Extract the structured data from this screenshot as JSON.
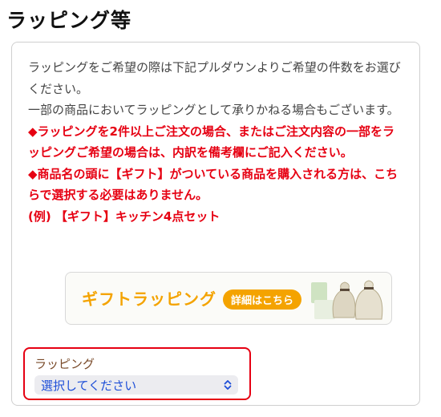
{
  "section": {
    "title": "ラッピング等"
  },
  "intro": {
    "normal": [
      "ラッピングをご希望の際は下記プルダウンよりご希望の件数をお選びください。",
      "一部の商品においてラッピングとして承りかねる場合もございます。"
    ],
    "notices": [
      "◆ラッピングを2件以上ご注文の場合、またはご注文内容の一部をラッピングご希望の場合は、内訳を備考欄にご記入ください。",
      "◆商品名の頭に【ギフト】がついている商品を購入される方は、こちらで選択する必要はありません。",
      "(例) 【ギフト】キッチン4点セット"
    ]
  },
  "banner": {
    "title": "ギフトラッピング",
    "badge": "詳細はこちら"
  },
  "wrapping_select": {
    "label": "ラッピング",
    "value": "選択してください"
  },
  "colors": {
    "notice_red": "#e60012",
    "banner_orange": "#f4a300",
    "select_text_blue": "#1d4ed8"
  }
}
